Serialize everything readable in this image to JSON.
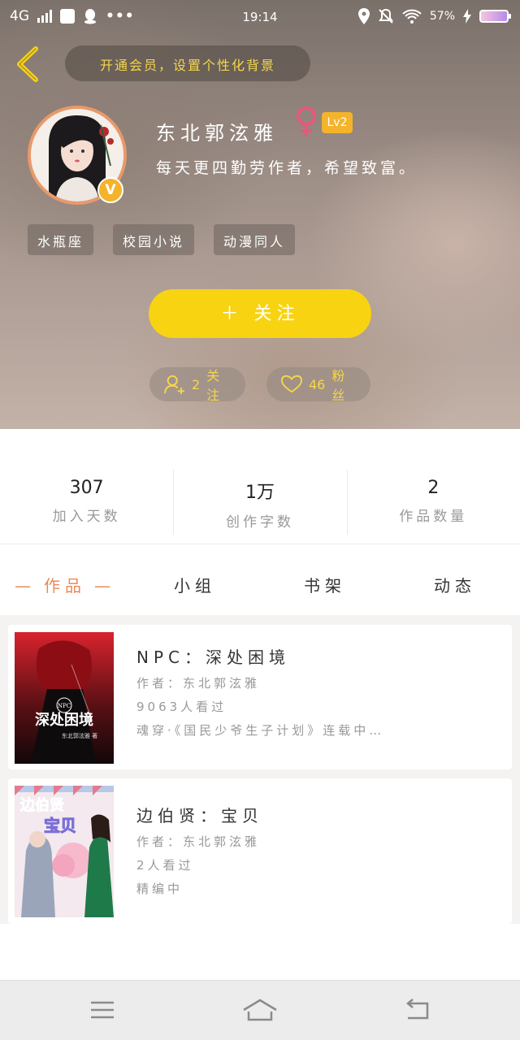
{
  "status_bar": {
    "network": "4G",
    "time": "19:14",
    "battery": "57%"
  },
  "header": {
    "vip_banner": "开通会员，设置个性化背景",
    "username": "东北郭泫雅",
    "level": "Lv2",
    "bio": "每天更四勤劳作者，希望致富。",
    "tags": [
      "水瓶座",
      "校园小说",
      "动漫同人"
    ],
    "follow_button": "＋ 关注",
    "following": {
      "count": "2",
      "label": "关注"
    },
    "fans": {
      "count": "46",
      "label": "粉丝"
    }
  },
  "stats": [
    {
      "value": "307",
      "label": "加入天数"
    },
    {
      "value": "1万",
      "label": "创作字数"
    },
    {
      "value": "2",
      "label": "作品数量"
    }
  ],
  "tabs": [
    "作品",
    "小组",
    "书架",
    "动态"
  ],
  "books": [
    {
      "title": "NPC：深处困境",
      "author": "作者：东北郭泫雅",
      "views": "9063人看过",
      "status": "魂穿·《国民少爷生子计划》连载中…",
      "cover_text": "深处困境",
      "cover_badge": "NPC",
      "cover_author": "东北郭泫雅 著"
    },
    {
      "title": "边伯贤：宝贝",
      "author": "作者：东北郭泫雅",
      "views": "2人看过",
      "status": "精编中",
      "cover_text": "边伯贤",
      "cover_sub": "宝贝"
    }
  ],
  "colors": {
    "accent": "#f8d312",
    "active_tab": "#e98a58",
    "badge": "#f4b32a",
    "female": "#e8577d"
  }
}
